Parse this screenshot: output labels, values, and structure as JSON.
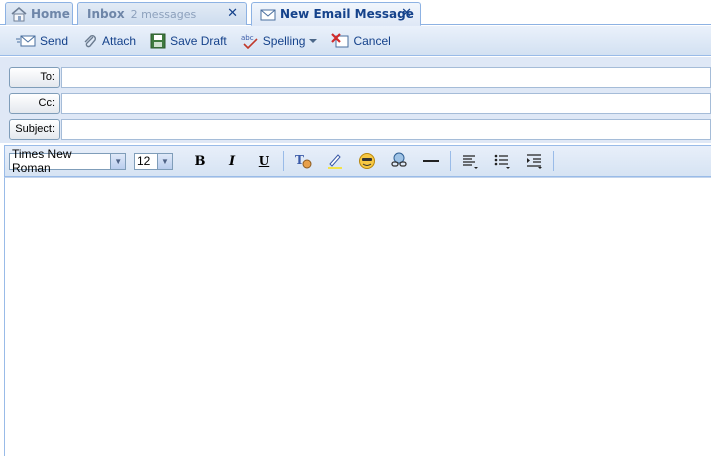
{
  "tabs": [
    {
      "label": "Home"
    },
    {
      "label": "Inbox",
      "sublabel": "2 messages"
    },
    {
      "label": "New Email Message"
    }
  ],
  "toolbar": {
    "send": "Send",
    "attach": "Attach",
    "save_draft": "Save Draft",
    "spelling": "Spelling",
    "cancel": "Cancel"
  },
  "fields": {
    "to_label": "To:",
    "cc_label": "Cc:",
    "subject_label": "Subject:",
    "to_value": "",
    "cc_value": "",
    "subject_value": ""
  },
  "format": {
    "font_family": "Times New Roman",
    "font_size": "12",
    "tools": [
      "bold-icon",
      "italic-icon",
      "underline-icon",
      "text-color-icon",
      "highlight-icon",
      "emoticon-icon",
      "insert-link-icon",
      "horizontal-rule-icon",
      "align-icon",
      "bullet-list-icon",
      "indent-icon"
    ]
  },
  "colors": {
    "accent": "#15428b",
    "toolbar_bg": "#dfe8f6",
    "border": "#99bbe8"
  }
}
